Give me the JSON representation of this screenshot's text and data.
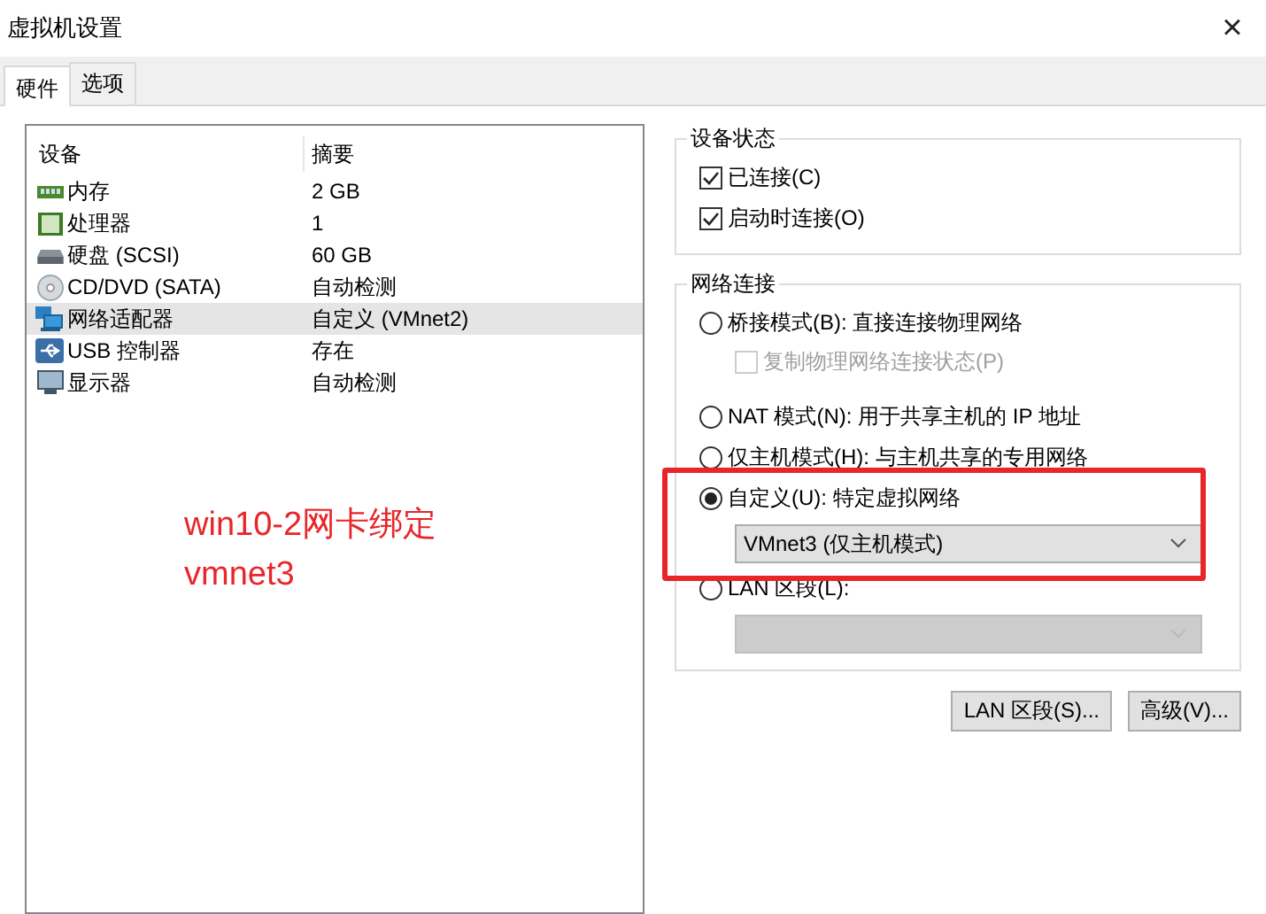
{
  "window": {
    "title": "虚拟机设置",
    "close": "×"
  },
  "tabs": [
    {
      "label": "硬件",
      "selected": true
    },
    {
      "label": "选项",
      "selected": false
    }
  ],
  "devices": {
    "columns": [
      "设备",
      "摘要"
    ],
    "rows": [
      {
        "kind": "memory",
        "device": "内存",
        "summary": "2 GB",
        "selected": false
      },
      {
        "kind": "cpu",
        "device": "处理器",
        "summary": "1",
        "selected": false
      },
      {
        "kind": "disk",
        "device": "硬盘 (SCSI)",
        "summary": "60 GB",
        "selected": false
      },
      {
        "kind": "cdrom",
        "device": "CD/DVD (SATA)",
        "summary": "自动检测",
        "selected": false
      },
      {
        "kind": "network",
        "device": "网络适配器",
        "summary": "自定义 (VMnet2)",
        "selected": true
      },
      {
        "kind": "usb",
        "device": "USB 控制器",
        "summary": "存在",
        "selected": false
      },
      {
        "kind": "display",
        "device": "显示器",
        "summary": "自动检测",
        "selected": false
      }
    ]
  },
  "annotation": {
    "lines": [
      "win10-2网卡绑定",
      "vmnet3"
    ]
  },
  "device_status": {
    "title": "设备状态",
    "items": [
      {
        "label": "已连接(C)",
        "checked": true
      },
      {
        "label": "启动时连接(O)",
        "checked": true
      }
    ]
  },
  "network_connection": {
    "title": "网络连接",
    "options": [
      {
        "kind": "radio",
        "label": "桥接模式(B): 直接连接物理网络",
        "selected": false
      },
      {
        "kind": "checkbox",
        "label": "复制物理网络连接状态(P)",
        "checked": false,
        "disabled": true
      },
      {
        "kind": "radio",
        "label": "NAT 模式(N): 用于共享主机的 IP 地址",
        "selected": false
      },
      {
        "kind": "radio",
        "label": "仅主机模式(H): 与主机共享的专用网络",
        "selected": false
      },
      {
        "kind": "radio",
        "label": "自定义(U): 特定虚拟网络",
        "selected": true
      },
      {
        "kind": "select",
        "value": "VMnet3 (仅主机模式)",
        "disabled": false
      },
      {
        "kind": "radio",
        "label": "LAN 区段(L):",
        "selected": false
      },
      {
        "kind": "select",
        "disabled": true
      }
    ]
  },
  "buttons": [
    "LAN 区段(S)...",
    "高级(V)..."
  ]
}
